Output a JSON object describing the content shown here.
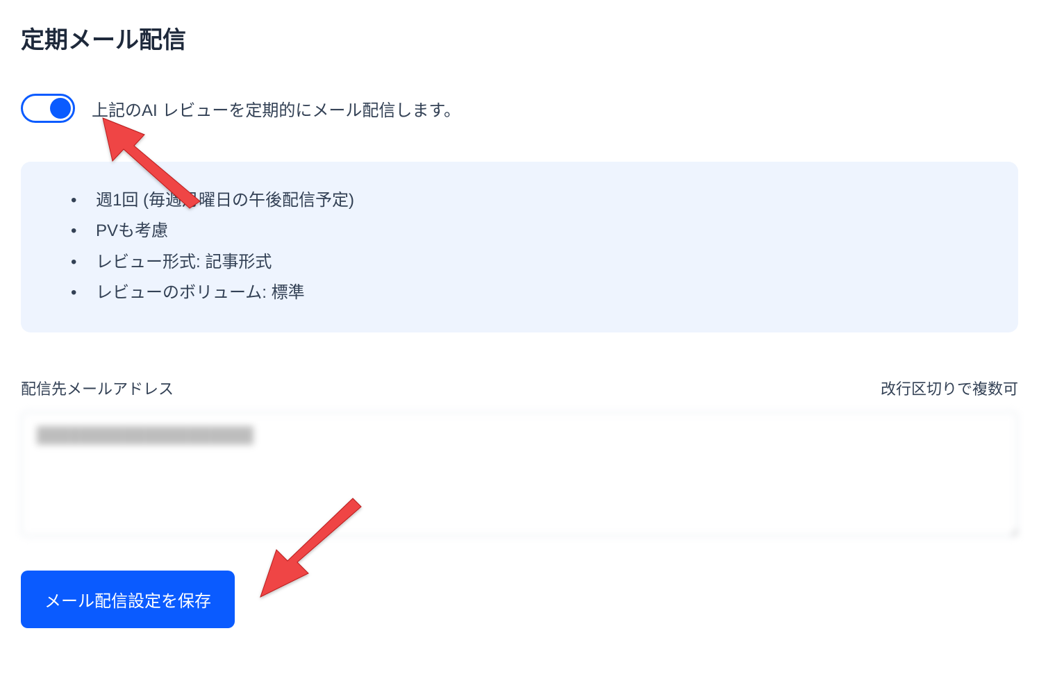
{
  "page": {
    "title": "定期メール配信"
  },
  "toggle": {
    "enabled": true,
    "label": "上記のAI レビューを定期的にメール配信します。"
  },
  "info": {
    "items": [
      "週1回 (毎週月曜日の午後配信予定)",
      "PVも考慮",
      "レビュー形式: 記事形式",
      "レビューのボリューム: 標準"
    ]
  },
  "emailField": {
    "label": "配信先メールアドレス",
    "hint": "改行区切りで複数可",
    "value": "████████████████████"
  },
  "actions": {
    "saveLabel": "メール配信設定を保存"
  },
  "colors": {
    "primary": "#0a5bff",
    "infoBg": "#eef4fe",
    "text": "#334155",
    "arrow": "#ef4444"
  }
}
